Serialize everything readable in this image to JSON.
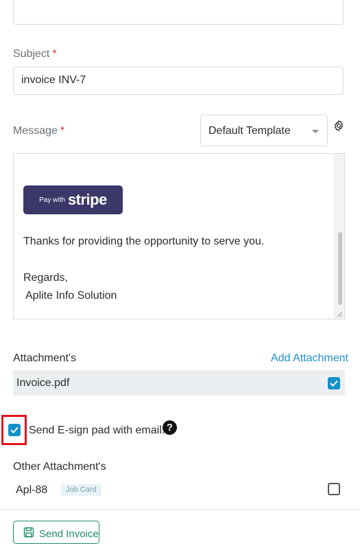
{
  "form": {
    "subject_label": "Subject",
    "required_mark": "*",
    "subject_value": "invoice INV-7",
    "message_label": "Message",
    "template_selected": "Default Template"
  },
  "editor": {
    "stripe_small": "Pay with",
    "stripe_logo": "stripe",
    "thanks_text": "Thanks for providing the opportunity to serve you.",
    "regards_text": "Regards,",
    "company_text": "Aplite Info Solution"
  },
  "attachments": {
    "label": "Attachment's",
    "add_link": "Add Attachment",
    "file_name": "Invoice.pdf",
    "file_checked": true
  },
  "esign": {
    "label": "Send E-sign pad with email.",
    "checked": true
  },
  "other_attachments": {
    "label": "Other Attachment's",
    "item_name": "Apl-88",
    "item_badge": "Job Card",
    "item_checked": false
  },
  "footer": {
    "send_label": "Send Invoice"
  },
  "colors": {
    "accent": "#1591c8",
    "link": "#1f8fc9",
    "stripe": "#3b3768",
    "send": "#1e8a6b",
    "highlight": "#e1141b",
    "required": "#d0312d"
  },
  "icons": [
    "gear-icon",
    "help-icon",
    "save-icon",
    "check-icon",
    "chevron-down-icon"
  ]
}
